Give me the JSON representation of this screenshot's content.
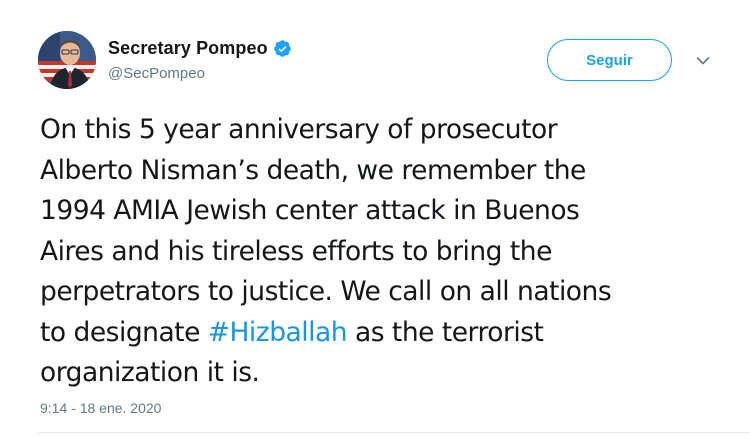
{
  "author": {
    "display_name": "Secretary Pompeo",
    "handle": "@SecPompeo",
    "verified": true,
    "avatar_icon": "profile-photo-icon"
  },
  "follow_button": {
    "label": "Seguir"
  },
  "more_icon": "chevron-down-icon",
  "tweet": {
    "text_before_hashtag": "On this 5 year anniversary of prosecutor\nAlberto Nisman’s death, we remember the\n1994 AMIA Jewish center attack in Buenos\nAires and his tireless efforts to bring the\nperpetrators to justice. We call on all nations\nto designate ",
    "hashtag": "#Hizballah",
    "text_after_hashtag": " as the terrorist\norganization it is.",
    "timestamp": "9:14 - 18 ene. 2020"
  },
  "colors": {
    "accent": "#1da1f2",
    "hashtag": "#1b95e0",
    "text": "#14171a",
    "muted": "#657786",
    "divider": "#e6ecf0"
  }
}
